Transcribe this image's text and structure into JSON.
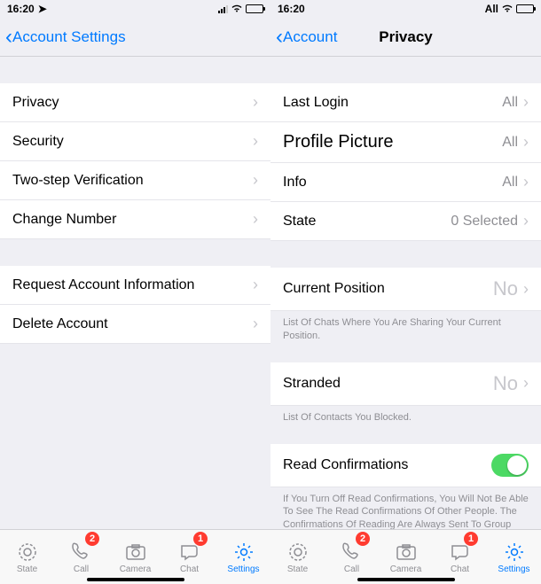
{
  "left": {
    "status_time": "16:20",
    "status_right_text": "",
    "nav_back": "Account Settings",
    "rows_a": [
      {
        "label": "Privacy"
      },
      {
        "label": "Security"
      },
      {
        "label": "Two-step Verification"
      },
      {
        "label": "Change Number"
      }
    ],
    "rows_b": [
      {
        "label": "Request Account Information"
      },
      {
        "label": "Delete Account"
      }
    ]
  },
  "right": {
    "status_time": "16:20",
    "status_right_text": "All",
    "nav_back": "Account",
    "nav_title": "Privacy",
    "rows_a": [
      {
        "label": "Last Login",
        "value": "All"
      },
      {
        "label": "Profile Picture",
        "value": "All",
        "lg": true
      },
      {
        "label": "Info",
        "value": "All"
      },
      {
        "label": "State",
        "value": "0 Selected"
      }
    ],
    "current_position": {
      "label": "Current Position",
      "value": "No"
    },
    "current_position_note": "List Of Chats Where You Are Sharing Your Current Position.",
    "stranded": {
      "label": "Stranded",
      "value": "No"
    },
    "stranded_note": "List Of Contacts You Blocked.",
    "read_conf": {
      "label": "Read Confirmations"
    },
    "read_conf_note": "If You Turn Off Read Confirmations, You Will Not Be Able To See The Read Confirmations Of Other People. The Confirmations Of Reading Are Always Sent To Group Chats."
  },
  "tabs": [
    {
      "label": "State",
      "icon": "status"
    },
    {
      "label": "Call",
      "icon": "phone",
      "badge": "2"
    },
    {
      "label": "Camera",
      "icon": "camera"
    },
    {
      "label": "Chat",
      "icon": "chat",
      "badge": "1"
    },
    {
      "label": "Settings",
      "icon": "gear",
      "active": true
    }
  ]
}
